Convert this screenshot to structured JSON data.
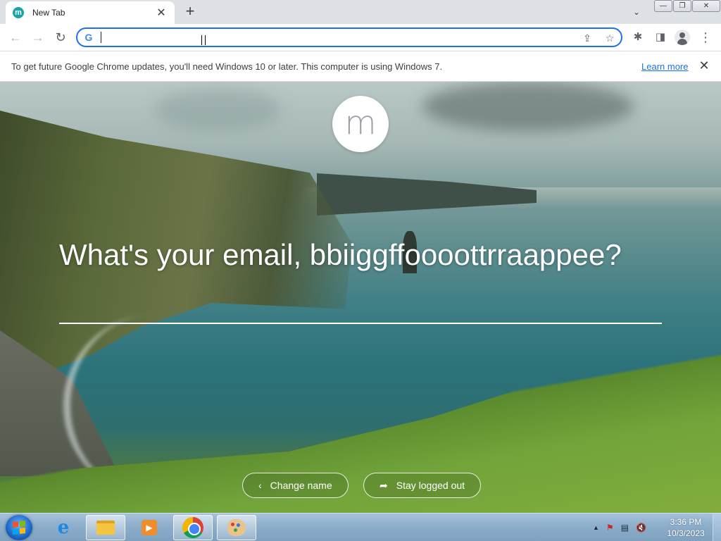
{
  "browser": {
    "tab": {
      "favicon_letter": "m",
      "title": "New Tab",
      "close_glyph": "✕"
    },
    "new_tab_glyph": "+",
    "tab_search_glyph": "⌄",
    "window_controls": {
      "minimize": "—",
      "restore": "❐",
      "close": "✕"
    }
  },
  "toolbar": {
    "back_glyph": "←",
    "forward_glyph": "→",
    "reload_glyph": "↻",
    "omnibox": {
      "value": "",
      "placeholder": "",
      "search_engine_icon": "G"
    },
    "share_glyph": "⇪",
    "bookmark_glyph": "☆",
    "extensions_glyph": "✱",
    "side_panel_glyph": "◨",
    "menu_glyph": "⋮"
  },
  "infobar": {
    "message": "To get future Google Chrome updates, you'll need Windows 10 or later. This computer is using Windows 7.",
    "learn_more": "Learn more",
    "close_glyph": "✕"
  },
  "newtab": {
    "logo_letter": "m",
    "question": "What's your email, bbiiggffoooottrraappee?",
    "email_value": "",
    "change_name_label": "Change name",
    "change_name_glyph": "‹",
    "stay_logged_out_label": "Stay logged out",
    "stay_logged_out_glyph": "➦"
  },
  "taskbar": {
    "apps": [
      {
        "name": "Internet Explorer",
        "icon": "ie-icon"
      },
      {
        "name": "Windows Explorer",
        "icon": "folder-icon"
      },
      {
        "name": "Windows Media Player",
        "icon": "media-player-icon"
      },
      {
        "name": "Google Chrome",
        "icon": "chrome-icon",
        "active": true
      },
      {
        "name": "Paint",
        "icon": "paint-icon"
      }
    ],
    "tray": {
      "show_hidden_glyph": "▲",
      "flag_glyph": "⚑",
      "network_glyph": "▤",
      "volume_glyph": "🔇"
    },
    "clock": {
      "time": "3:36 PM",
      "date": "10/3/2023"
    }
  }
}
